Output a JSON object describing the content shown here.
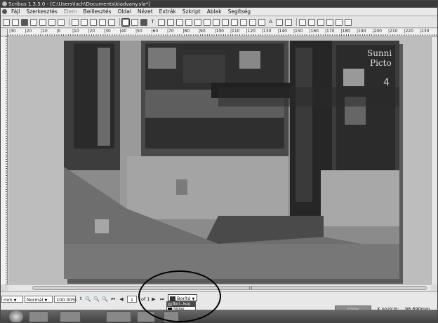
{
  "window": {
    "title": "Scribus 1.3.5.0 - [C:\\Users\\lach\\Documents\\kiadvany.sla*]"
  },
  "menubar": {
    "items": [
      {
        "label": "Fájl",
        "disabled": false
      },
      {
        "label": "Szerkesztés",
        "disabled": false
      },
      {
        "label": "Elem",
        "disabled": true
      },
      {
        "label": "Beillesztés",
        "disabled": false
      },
      {
        "label": "Oldal",
        "disabled": false
      },
      {
        "label": "Nézet",
        "disabled": false
      },
      {
        "label": "Extrák",
        "disabled": false
      },
      {
        "label": "Szkript",
        "disabled": false
      },
      {
        "label": "Ablak",
        "disabled": false
      },
      {
        "label": "Segítség",
        "disabled": false
      }
    ]
  },
  "toolbar": {
    "text_tool": "T",
    "special_char": "A"
  },
  "ruler": {
    "ticks": [
      "|30",
      "|20",
      "|10",
      "|0",
      "|10",
      "|20",
      "|30",
      "|40",
      "|50",
      "|60",
      "|70",
      "|80",
      "|90",
      "|100",
      "|110",
      "|120",
      "|130",
      "|140",
      "|150",
      "|160",
      "|170",
      "|180",
      "|190",
      "|200",
      "|210",
      "|220",
      "|230"
    ]
  },
  "canvas": {
    "photo_sign_text": "Sunni",
    "photo_sign_text2": "Picto",
    "photo_sign_number": "4"
  },
  "scrollbar": {
    "grip": "III"
  },
  "statusbar": {
    "unit": "mm",
    "mode": "Normál",
    "zoom": "100.00%",
    "page_current": "1",
    "page_of": "of 1",
    "layer": "Borító",
    "layer_options": [
      "Borí...lezg",
      "Hátlap"
    ],
    "zoom_box": "100%",
    "x_position_label": "X pozíció:",
    "x_position_value": "98.690mm"
  },
  "colors": {
    "title_bar": "#3a3a3a",
    "page_photo_tone": "#8a8a8a",
    "annotation": "#000000"
  }
}
